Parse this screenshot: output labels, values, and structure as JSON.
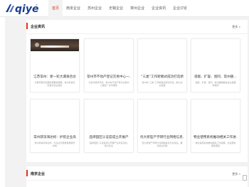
{
  "header": {
    "logo_text": "qiye",
    "nav": [
      {
        "label": "首页",
        "active": true
      },
      {
        "label": "南京企业",
        "active": false
      },
      {
        "label": "苏州企业",
        "active": false
      },
      {
        "label": "无锡企业",
        "active": false
      },
      {
        "label": "常州企业",
        "active": false
      },
      {
        "label": "企业资讯",
        "active": false
      },
      {
        "label": "企业讨论",
        "active": false
      }
    ]
  },
  "sections": {
    "news": {
      "title": "企业资讯",
      "more": "更多 »",
      "cards": [
        {
          "title": "江苏常州：新一轮大漏排合达",
          "summary": "为贯彻落实近期市委要求部署，常州市金坛区重点企业组织"
        },
        {
          "title": "常州市不动产登记交易中心一…",
          "summary": "为优化营商环境，常州市不动产登记交易中心推出一系列便民"
        },
        {
          "title": "“三类”工作新模式成功打造新",
          "summary": "常州市“三类”工作新模式成功打造，助力企业发展"
        },
        {
          "title": "提能、扩容、连同、常州捆…",
          "summary": "提能、扩容、连同，常州捆绑推进企业发展新格局"
        },
        {
          "title": "常州获滨海达标：护航企业高",
          "summary": "常州获得滨海达标，为企业高质量发展保驾护航"
        },
        {
          "title": "品牌园区认证度成立开展产",
          "summary": "“品牌园区”认证度成立开展产业对接活动，助力企业"
        },
        {
          "title": "优大新型产学研行业网络信息…",
          "summary": "优大新型产学研行业网络信息平台建设，推动企业创新"
        },
        {
          "title": "物业使用系统推动相关工作进…",
          "summary": "物业使用系统推动相关工作进展，企业服务更加便捷"
        }
      ]
    },
    "nanjing": {
      "title": "南京企业",
      "more": "更多 »"
    }
  },
  "colors": {
    "accent": "#e0321e",
    "logo_blue": "#1a3f8f"
  }
}
